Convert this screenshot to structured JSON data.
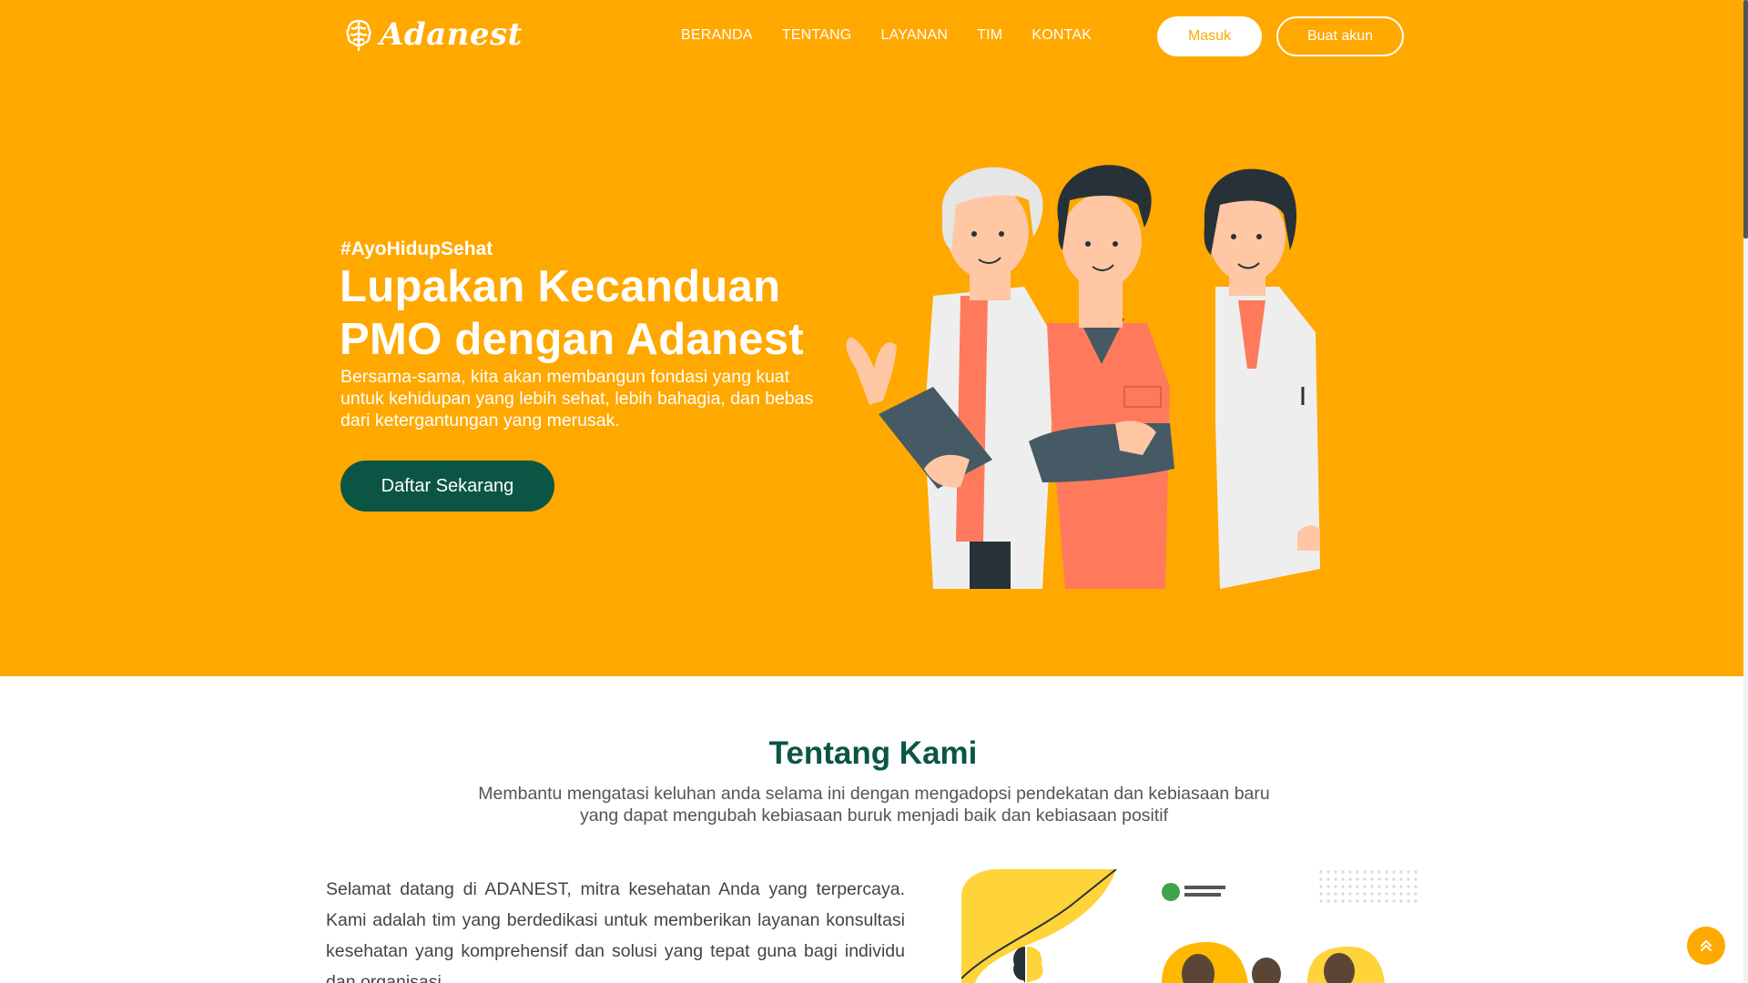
{
  "brand": {
    "name": "Adanest"
  },
  "nav": {
    "items": [
      "BERANDA",
      "TENTANG",
      "LAYANAN",
      "TIM",
      "KONTAK"
    ],
    "login_label": "Masuk",
    "register_label": "Buat akun"
  },
  "hero": {
    "hashtag": "#AyoHidupSehat",
    "title": "Lupakan Kecanduan PMO dengan Adanest",
    "description": "Bersama-sama, kita akan membangun fondasi yang kuat untuk kehidupan yang lebih sehat, lebih bahagia, dan bebas dari ketergantungan yang merusak.",
    "cta_label": "Daftar Sekarang"
  },
  "about": {
    "title": "Tentang Kami",
    "subtitle": "Membantu mengatasi keluhan anda selama ini dengan mengadopsi pendekatan dan kebiasaan baru yang dapat mengubah kebiasaan buruk menjadi baik dan kebiasaan positif",
    "body": "Selamat datang di ADANEST, mitra kesehatan Anda yang terpercaya. Kami adalah tim yang berdedikasi untuk memberikan layanan konsultasi kesehatan yang komprehensif dan solusi yang tepat guna bagi individu dan organisasi."
  },
  "colors": {
    "primary": "#FFA800",
    "dark_green": "#0B5545",
    "white": "#ffffff"
  },
  "icons": {
    "logo": "brain-icon",
    "back_to_top": "double-chevron-up-icon"
  }
}
